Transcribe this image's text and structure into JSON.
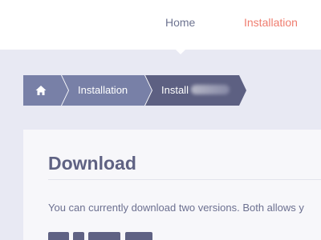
{
  "nav": {
    "items": [
      {
        "label": "Home",
        "active": true
      },
      {
        "label": "Installation",
        "active": false
      }
    ]
  },
  "breadcrumb": {
    "home_icon": "house-icon",
    "items": [
      {
        "label": "Installation"
      },
      {
        "label": "Install"
      }
    ]
  },
  "content": {
    "title": "Download",
    "intro": "You can currently download two versions. Both allows y"
  },
  "colors": {
    "background": "#e8e9f3",
    "nav_text": "#6e7491",
    "nav_accent": "#ef7d6f",
    "breadcrumb": "#7880a7",
    "breadcrumb_current": "#5d6082",
    "heading": "#5f6283"
  }
}
